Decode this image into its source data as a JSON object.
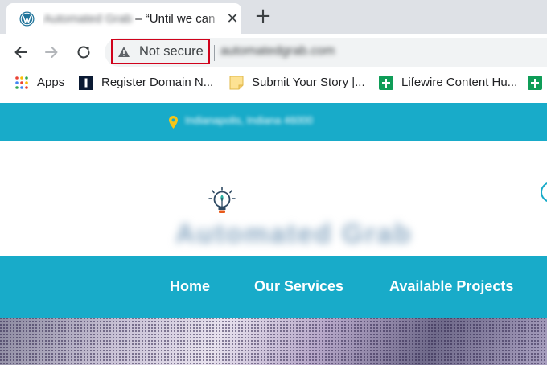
{
  "browser": {
    "tab": {
      "title_blurred": "Automated Grab",
      "title_visible": " – “Until we can",
      "close_glyph": "✕"
    },
    "new_tab_glyph": "+",
    "address_bar": {
      "security_label": "Not secure",
      "url": "automatedgrab.com"
    },
    "bookmarks": [
      {
        "label": "Apps",
        "icon": "apps-grid-icon"
      },
      {
        "label": "Register Domain N...",
        "icon": "domain-registrar-icon"
      },
      {
        "label": "Submit Your Story |...",
        "icon": "sticky-note-icon"
      },
      {
        "label": "Lifewire Content Hu...",
        "icon": "sheets-icon"
      },
      {
        "label": "",
        "icon": "sheets-icon"
      }
    ]
  },
  "site": {
    "address": "Indianapolis, Indiana 46000",
    "name": "Automated Grab",
    "nav": [
      "Home",
      "Our Services",
      "Available Projects"
    ],
    "colors": {
      "brand": "#18abc9",
      "warning_outline": "#d0021b"
    }
  }
}
